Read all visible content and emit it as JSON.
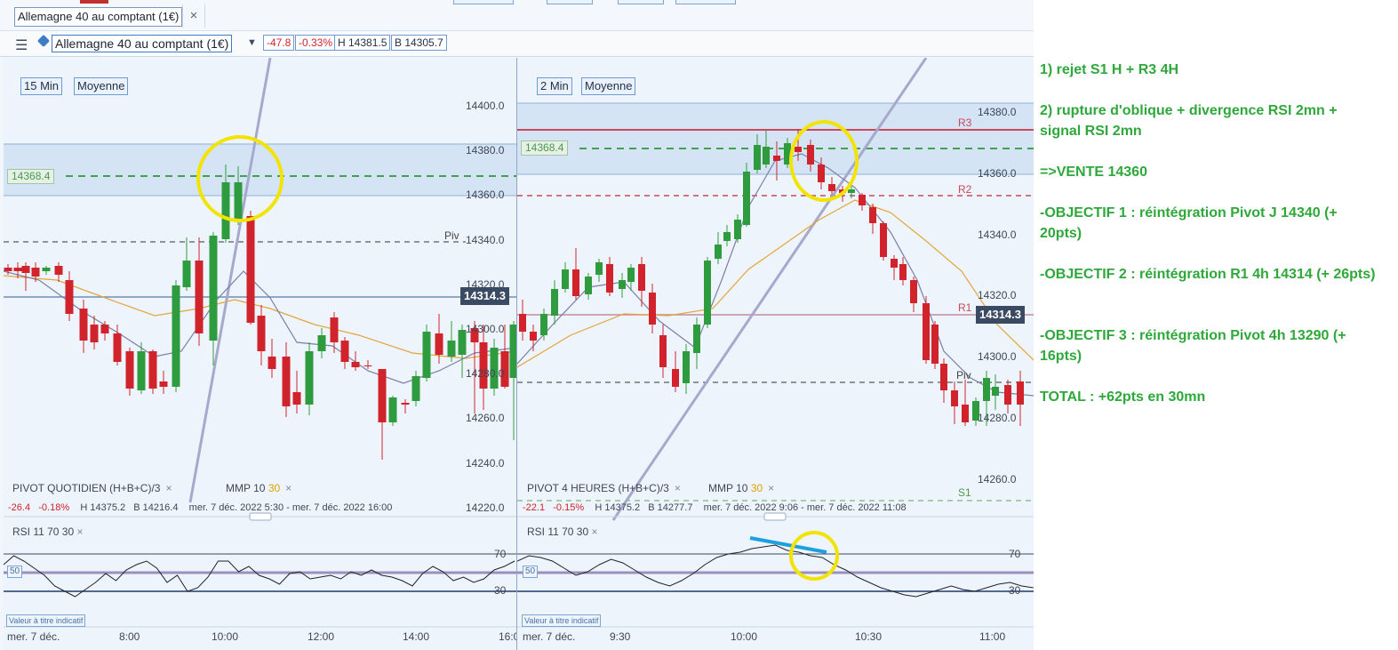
{
  "tabbar": {
    "tab_label": "Allemagne 40 au comptant (1€)",
    "close_label": "×"
  },
  "toolbar": {
    "menu_icon": "hamburger-icon",
    "tag_icon": "tag-icon",
    "instrument": "Allemagne 40 au comptant (1€)",
    "change": "-47.8",
    "change_pct": "-0.33%",
    "high": "H 14381.5",
    "low": "B 14305.7"
  },
  "left": {
    "timeframe": "15 Min",
    "average": "Moyenne",
    "pivot_legend": "PIVOT  QUOTIDIEN  (H+B+C)/3",
    "mmp_label": "MMP  10",
    "mmp_period2": "30",
    "close": "×",
    "info_change": "-26.4",
    "info_pct": "-0.18%",
    "info_high": "H 14375.2",
    "info_low": "B 14216.4",
    "info_range": "mer. 7 déc. 2022 5:30 - mer. 7 déc. 2022 16:00",
    "zone_label": "14368.4",
    "piv_label": "Piv",
    "last_price": "14314.3",
    "y_ticks": [
      "14400.0",
      "14380.0",
      "14360.0",
      "14340.0",
      "14320.0",
      "14300.0",
      "14280.0",
      "14260.0",
      "14240.0",
      "14220.0"
    ],
    "rsi_legend": "RSI  11  70  30",
    "rsi_ticks": [
      "70",
      "30"
    ],
    "rsi_mid": "50",
    "rsi_note": "Valeur à titre indicatif",
    "x_ticks": [
      "mer. 7 déc.",
      "8:00",
      "10:00",
      "12:00",
      "14:00",
      "16:0"
    ]
  },
  "right": {
    "timeframe": "2 Min",
    "average": "Moyenne",
    "pivot_legend": "PIVOT  4 HEURES  (H+B+C)/3",
    "mmp_label": "MMP  10",
    "mmp_period2": "30",
    "close": "×",
    "info_change": "-22.1",
    "info_pct": "-0.15%",
    "info_high": "H 14375.2",
    "info_low": "B 14277.7",
    "info_range": "mer. 7 déc. 2022 9:06 - mer. 7 déc. 2022 11:08",
    "zone_label": "14368.4",
    "levels": {
      "r3": "R3",
      "r2": "R2",
      "r1": "R1",
      "piv": "Piv",
      "s1": "S1"
    },
    "last_price": "14314.3",
    "y_ticks": [
      "14380.0",
      "14360.0",
      "14340.0",
      "14320.0",
      "14300.0",
      "14280.0",
      "14260.0"
    ],
    "rsi_legend": "RSI  11  70  30",
    "rsi_ticks": [
      "70",
      "30"
    ],
    "rsi_mid": "50",
    "rsi_note": "Valeur à titre indicatif",
    "x_ticks": [
      "mer. 7 déc.",
      "9:30",
      "10:00",
      "10:30",
      "11:00"
    ]
  },
  "annotations": [
    "1) rejet S1 H + R3 4H",
    "2) rupture d'oblique + divergence RSI 2mn + signal RSI 2mn",
    "=>VENTE 14360",
    "-OBJECTIF 1 : réintégration Pivot J 14340 (+ 20pts)",
    "-OBJECTIF 2 : réintégration R1 4h 14314 (+ 26pts)",
    "-OBJECTIF 3 : réintégration Pivot 4h 13290 (+ 16pts)",
    "TOTAL : +62pts en 30mn"
  ],
  "colors": {
    "up": "#2e9b3e",
    "down": "#d0232c",
    "ma_fast": "#7a7fa8",
    "ma_slow": "#e2a540",
    "accent": "#3a7cc9",
    "annotation": "#2ea83a",
    "highlight": "#ffee00"
  }
}
